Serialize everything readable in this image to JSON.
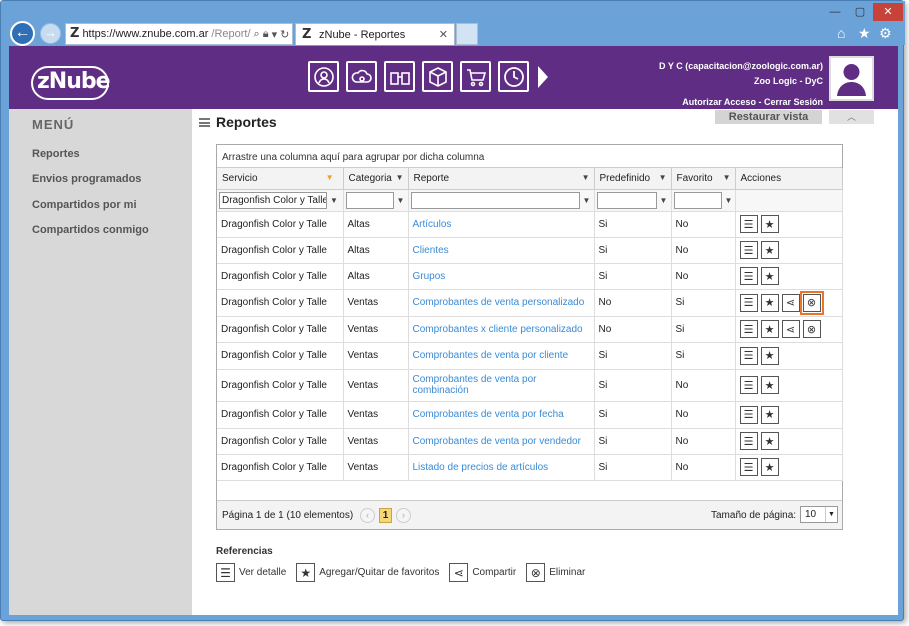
{
  "browser": {
    "url_main": "https://www.znube.com.ar",
    "url_rest": "/Report/",
    "tab_title": "zNube - Reportes"
  },
  "header": {
    "brand": "zNube",
    "user_line1": "D Y C (capacitacion@zoologic.com.ar)",
    "user_line2": "Zoo Logic - DyC",
    "link_authorize": "Autorizar Acceso",
    "link_separator": "-",
    "link_logout": "Cerrar Sesión"
  },
  "sidebar": {
    "title": "MENÚ",
    "items": [
      {
        "label": "Reportes"
      },
      {
        "label": "Envios programados"
      },
      {
        "label": "Compartidos por mi"
      },
      {
        "label": "Compartidos conmigo"
      }
    ]
  },
  "main": {
    "title": "Reportes",
    "restore_label": "Restaurar vista",
    "group_hint": "Arrastre una columna aquí para agrupar por dicha columna",
    "columns": [
      "Servicio",
      "Categoria",
      "Reporte",
      "Predefinido",
      "Favorito",
      "Acciones"
    ],
    "filter_servicio": "Dragonfish Color y Talle",
    "rows": [
      {
        "servicio": "Dragonfish Color y Talle",
        "categoria": "Altas",
        "reporte": "Artículos",
        "predefinido": "Si",
        "favorito": "No",
        "share": false,
        "highlight": false
      },
      {
        "servicio": "Dragonfish Color y Talle",
        "categoria": "Altas",
        "reporte": "Clientes",
        "predefinido": "Si",
        "favorito": "No",
        "share": false,
        "highlight": false
      },
      {
        "servicio": "Dragonfish Color y Talle",
        "categoria": "Altas",
        "reporte": "Grupos",
        "predefinido": "Si",
        "favorito": "No",
        "share": false,
        "highlight": false
      },
      {
        "servicio": "Dragonfish Color y Talle",
        "categoria": "Ventas",
        "reporte": "Comprobantes de venta personalizado",
        "predefinido": "No",
        "favorito": "Si",
        "share": true,
        "highlight": true
      },
      {
        "servicio": "Dragonfish Color y Talle",
        "categoria": "Ventas",
        "reporte": "Comprobantes x cliente personalizado",
        "predefinido": "No",
        "favorito": "Si",
        "share": true,
        "highlight": false
      },
      {
        "servicio": "Dragonfish Color y Talle",
        "categoria": "Ventas",
        "reporte": "Comprobantes de venta por cliente",
        "predefinido": "Si",
        "favorito": "Si",
        "share": false,
        "highlight": false
      },
      {
        "servicio": "Dragonfish Color y Talle",
        "categoria": "Ventas",
        "reporte": "Comprobantes de venta por combinación",
        "predefinido": "Si",
        "favorito": "No",
        "share": false,
        "highlight": false
      },
      {
        "servicio": "Dragonfish Color y Talle",
        "categoria": "Ventas",
        "reporte": "Comprobantes de venta por fecha",
        "predefinido": "Si",
        "favorito": "No",
        "share": false,
        "highlight": false
      },
      {
        "servicio": "Dragonfish Color y Talle",
        "categoria": "Ventas",
        "reporte": "Comprobantes de venta por vendedor",
        "predefinido": "Si",
        "favorito": "No",
        "share": false,
        "highlight": false
      },
      {
        "servicio": "Dragonfish Color y Talle",
        "categoria": "Ventas",
        "reporte": "Listado de precios de artículos",
        "predefinido": "Si",
        "favorito": "No",
        "share": false,
        "highlight": false
      }
    ],
    "pager": {
      "info": "Página 1 de 1 (10 elementos)",
      "current_page": "1",
      "size_label": "Tamaño de página:",
      "size_value": "10"
    },
    "refs_title": "Referencias",
    "refs": [
      {
        "icon": "list-icon",
        "label": "Ver detalle"
      },
      {
        "icon": "star-icon",
        "label": "Agregar/Quitar de favoritos"
      },
      {
        "icon": "share-icon",
        "label": "Compartir"
      },
      {
        "icon": "close-circle-icon",
        "label": "Eliminar"
      }
    ]
  }
}
